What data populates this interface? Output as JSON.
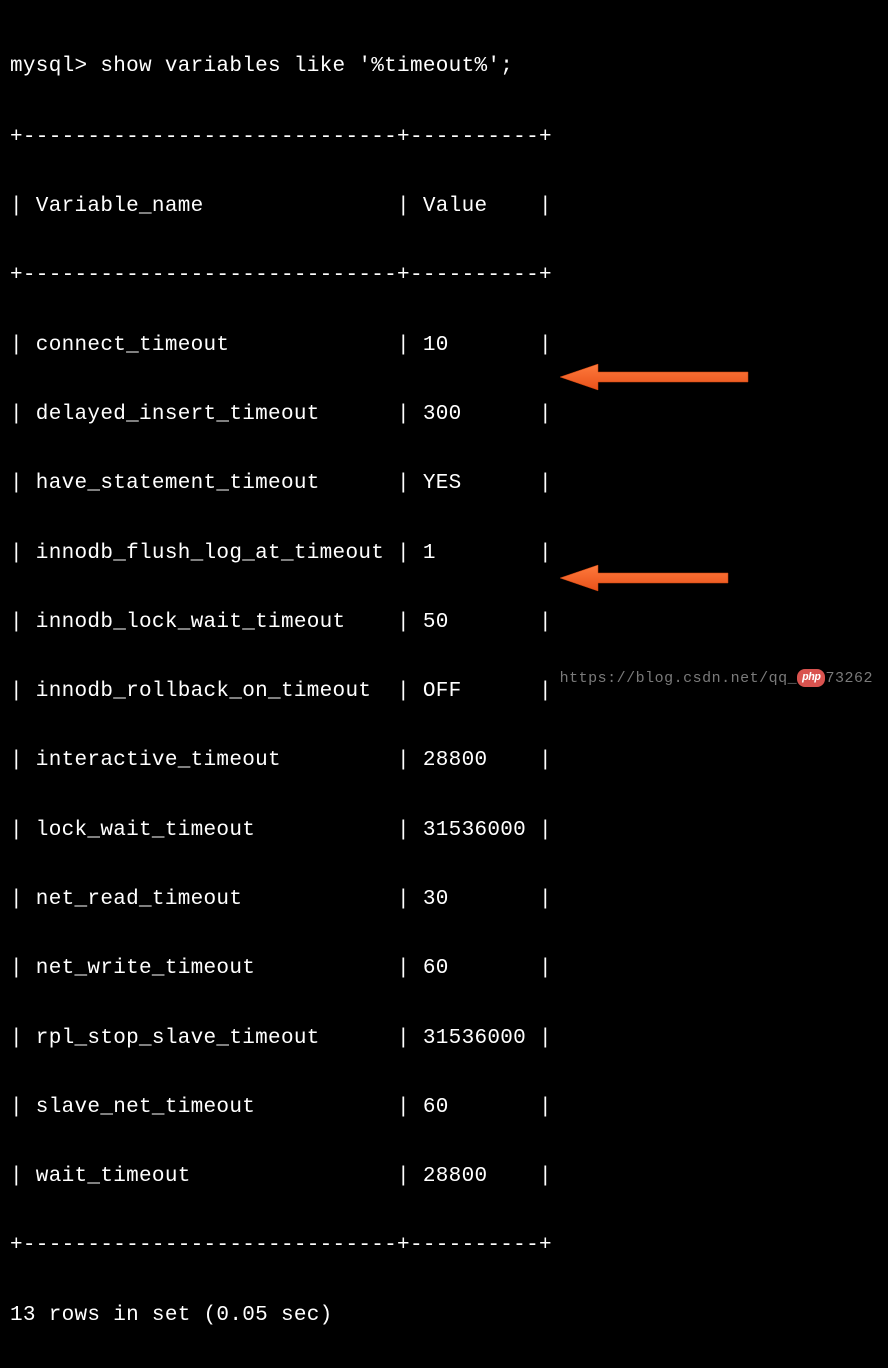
{
  "prompt": "mysql> show variables like '%timeout%';",
  "table": {
    "border_top": "+-----------------------------+----------+",
    "header": "| Variable_name               | Value    |",
    "border_mid": "+-----------------------------+----------+",
    "rows": [
      "| connect_timeout             | 10       |",
      "| delayed_insert_timeout      | 300      |",
      "| have_statement_timeout      | YES      |",
      "| innodb_flush_log_at_timeout | 1        |",
      "| innodb_lock_wait_timeout    | 50       |",
      "| innodb_rollback_on_timeout  | OFF      |",
      "| interactive_timeout         | 28800    |",
      "| lock_wait_timeout           | 31536000 |",
      "| net_read_timeout            | 30       |",
      "| net_write_timeout           | 60       |",
      "| rpl_stop_slave_timeout      | 31536000 |",
      "| slave_net_timeout           | 60       |",
      "| wait_timeout                | 28800    |"
    ],
    "border_bottom": "+-----------------------------+----------+"
  },
  "result_summary": "13 rows in set (0.05 sec)",
  "watermark": {
    "text_before": "https://blog.csdn.net/qq_",
    "badge": "php",
    "text_after": "73262"
  },
  "chart_data": {
    "type": "table",
    "title": "MySQL timeout variables",
    "columns": [
      "Variable_name",
      "Value"
    ],
    "rows": [
      [
        "connect_timeout",
        "10"
      ],
      [
        "delayed_insert_timeout",
        "300"
      ],
      [
        "have_statement_timeout",
        "YES"
      ],
      [
        "innodb_flush_log_at_timeout",
        "1"
      ],
      [
        "innodb_lock_wait_timeout",
        "50"
      ],
      [
        "innodb_rollback_on_timeout",
        "OFF"
      ],
      [
        "interactive_timeout",
        "28800"
      ],
      [
        "lock_wait_timeout",
        "31536000"
      ],
      [
        "net_read_timeout",
        "30"
      ],
      [
        "net_write_timeout",
        "60"
      ],
      [
        "rpl_stop_slave_timeout",
        "31536000"
      ],
      [
        "slave_net_timeout",
        "60"
      ],
      [
        "wait_timeout",
        "28800"
      ]
    ],
    "highlighted_rows": [
      "interactive_timeout",
      "wait_timeout"
    ]
  }
}
